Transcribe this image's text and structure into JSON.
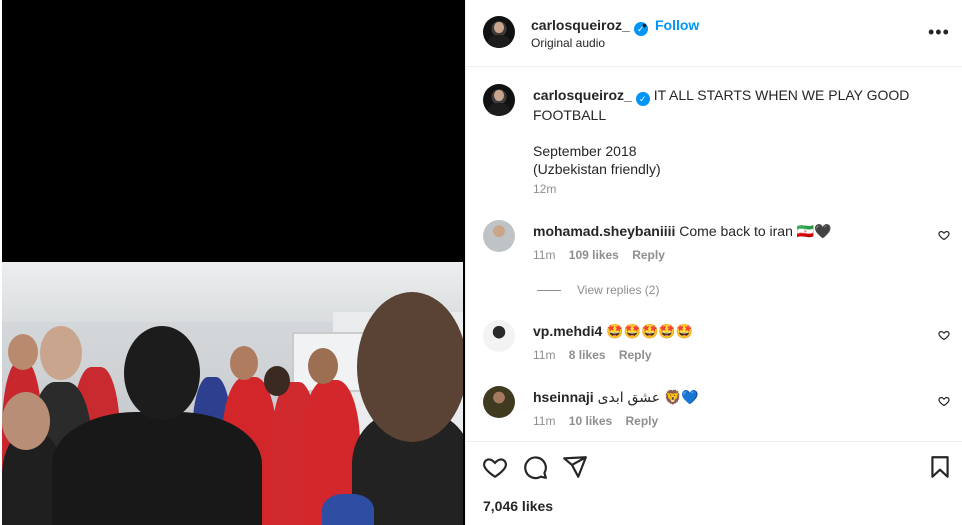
{
  "post": {
    "username": "carlosqueiroz_",
    "verified_glyph": "✓",
    "separator": "•",
    "follow_label": "Follow",
    "audio": "Original audio",
    "more_glyph": "•••",
    "caption_lines": [
      "IT ALL STARTS WHEN WE PLAY GOOD",
      "FOOTBALL",
      "",
      "September 2018",
      "(Uzbekistan friendly)"
    ],
    "caption_time": "12m",
    "likes": "7,046 likes"
  },
  "comments": [
    {
      "username": "mohamad.sheybaniiii",
      "text": "Come back to iran 🇮🇷🖤",
      "time": "11m",
      "likes": "109 likes",
      "reply_label": "Reply",
      "view_replies": "View replies (2)"
    },
    {
      "username": "vp.mehdi4",
      "text": "🤩🤩🤩🤩🤩",
      "time": "11m",
      "likes": "8 likes",
      "reply_label": "Reply"
    },
    {
      "username": "hseinnaji",
      "text": "عشق ابدی 🦁💙",
      "time": "11m",
      "likes": "10 likes",
      "reply_label": "Reply"
    }
  ],
  "icons": {
    "like": "heart-icon",
    "comment": "comment-icon",
    "share": "share-icon",
    "save": "bookmark-icon",
    "more": "more-icon",
    "comment_like": "heart-icon"
  },
  "colors": {
    "accent": "#0095f6",
    "muted": "#8e8e8e",
    "text": "#262626"
  }
}
